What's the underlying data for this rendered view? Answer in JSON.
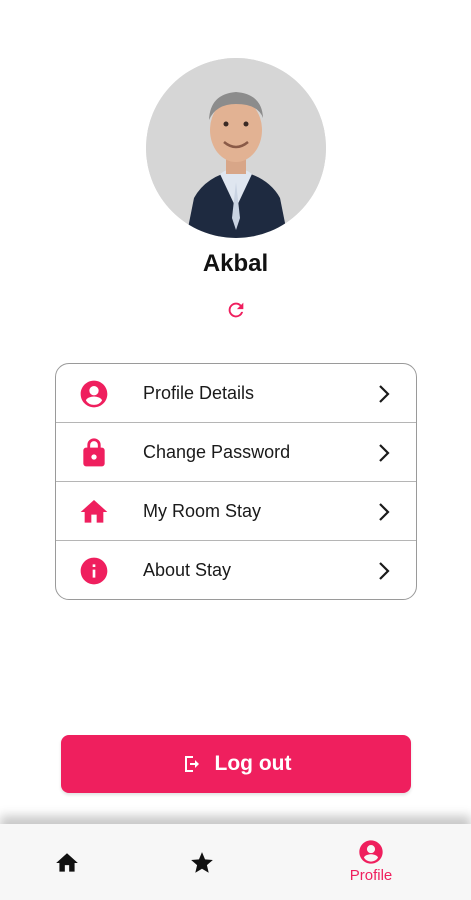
{
  "profile": {
    "name": "Akbal",
    "avatar_alt": "profile photo",
    "refresh_icon": "refresh-icon"
  },
  "menu": {
    "items": [
      {
        "label": "Profile Details",
        "icon": "account-circle-icon"
      },
      {
        "label": "Change Password",
        "icon": "lock-icon"
      },
      {
        "label": "My Room Stay",
        "icon": "home-icon"
      },
      {
        "label": "About Stay",
        "icon": "info-icon"
      }
    ]
  },
  "logout": {
    "label": "Log out",
    "icon": "logout-icon"
  },
  "bottom_nav": {
    "items": [
      {
        "id": "home",
        "icon": "home-icon",
        "label": ""
      },
      {
        "id": "favorites",
        "icon": "star-icon",
        "label": ""
      },
      {
        "id": "profile",
        "icon": "account-circle-icon",
        "label": "Profile",
        "active": true
      }
    ]
  },
  "colors": {
    "accent": "#ef1f5e",
    "text": "#1a1a1a",
    "nav_background": "#f7f7f7",
    "card_border": "#9a9a9a"
  }
}
